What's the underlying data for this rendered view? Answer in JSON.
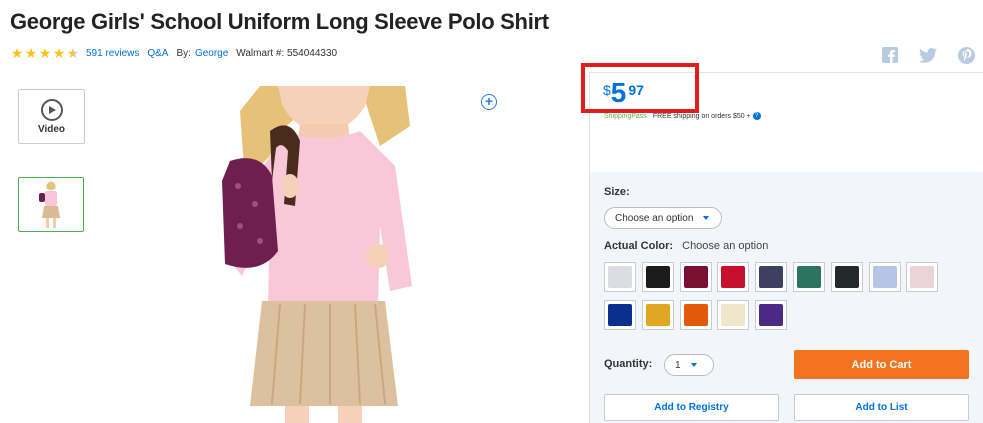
{
  "product": {
    "title": "George Girls' School Uniform Long Sleeve Polo Shirt",
    "rating": 4.5,
    "reviews_label": "591 reviews",
    "qa_label": "Q&A",
    "by_label": "By:",
    "brand": "George",
    "walmart_number_label": "Walmart #: 554044330"
  },
  "media": {
    "video_label": "Video"
  },
  "price": {
    "currency": "$",
    "dollars": "5",
    "cents": "97"
  },
  "shipping": {
    "pass_label": "ShippingPass",
    "free_text": "FREE shipping on orders $50 +"
  },
  "options": {
    "size_label": "Size:",
    "size_placeholder": "Choose an option",
    "color_label": "Actual Color:",
    "color_value": "Choose an option",
    "swatches": [
      {
        "name": "light-gray",
        "color": "#dcdde3"
      },
      {
        "name": "black",
        "color": "#1b1b1b"
      },
      {
        "name": "burgundy",
        "color": "#7a0f32"
      },
      {
        "name": "red",
        "color": "#c8102e"
      },
      {
        "name": "charcoal-navy",
        "color": "#3d3f63"
      },
      {
        "name": "green",
        "color": "#2d7460"
      },
      {
        "name": "dark-green",
        "color": "#232a2b"
      },
      {
        "name": "light-blue",
        "color": "#b8c4e6"
      },
      {
        "name": "light-pink",
        "color": "#ecd3d7"
      },
      {
        "name": "royal-blue",
        "color": "#0b2f8c"
      },
      {
        "name": "gold",
        "color": "#e0a822"
      },
      {
        "name": "orange",
        "color": "#e05a0a"
      },
      {
        "name": "cream",
        "color": "#f0e6cc"
      },
      {
        "name": "purple",
        "color": "#4b2a86"
      }
    ]
  },
  "purchase": {
    "quantity_label": "Quantity:",
    "quantity_value": "1",
    "add_to_cart": "Add to Cart",
    "add_to_registry": "Add to Registry",
    "add_to_list": "Add to List"
  },
  "colors": {
    "brand_blue": "#0071dc",
    "cart_orange": "#f47321",
    "highlight_red": "#e21b1b",
    "star_yellow": "#ffc220"
  }
}
